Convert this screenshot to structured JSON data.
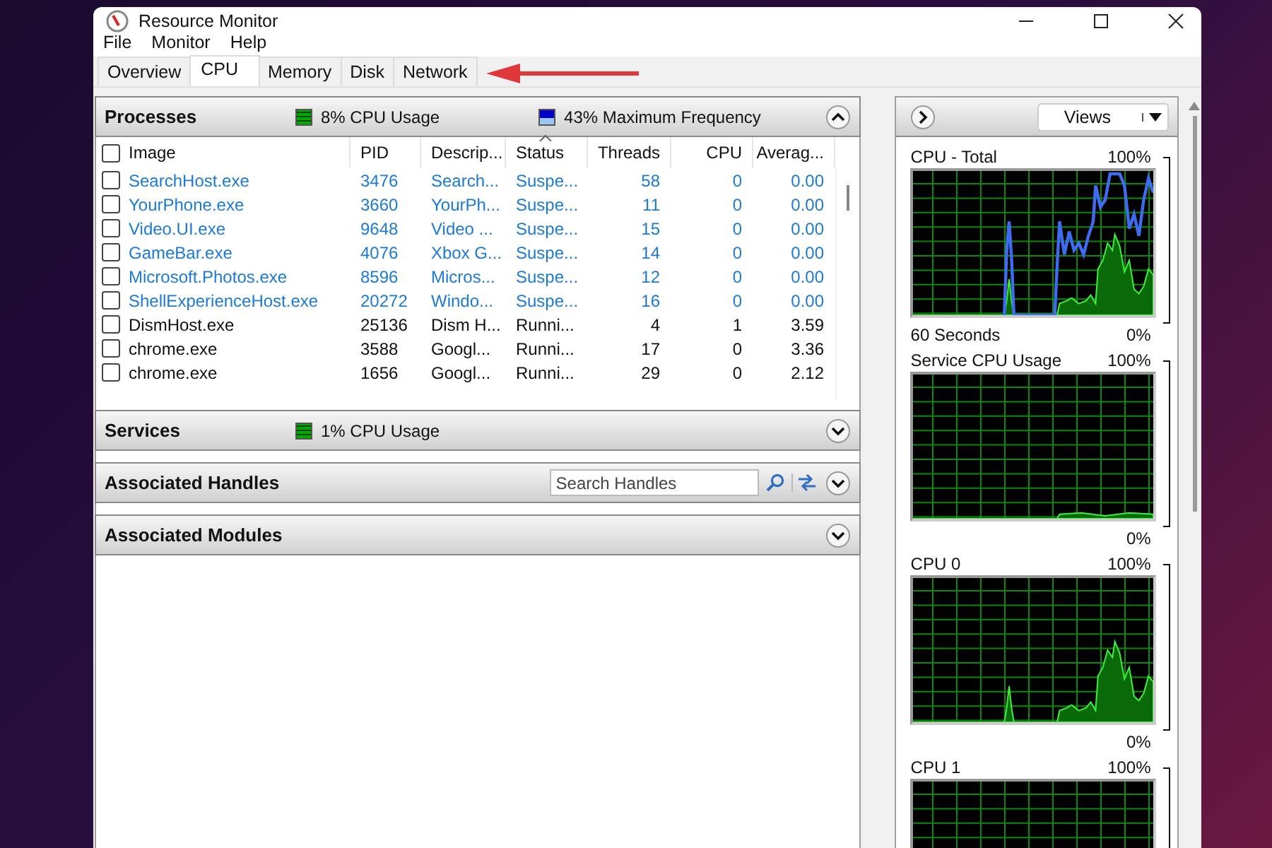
{
  "window": {
    "title": "Resource Monitor"
  },
  "menu": [
    "File",
    "Monitor",
    "Help"
  ],
  "tabs": [
    {
      "label": "Overview",
      "selected": false
    },
    {
      "label": "CPU",
      "selected": true
    },
    {
      "label": "Memory",
      "selected": false
    },
    {
      "label": "Disk",
      "selected": false
    },
    {
      "label": "Network",
      "selected": false
    }
  ],
  "processes": {
    "title": "Processes",
    "select_all_checked": false,
    "cpu_usage": "8% CPU Usage",
    "max_frequency": "43% Maximum Frequency",
    "expanded": true,
    "columns": [
      "Image",
      "PID",
      "Descrip...",
      "Status",
      "Threads",
      "CPU",
      "Averag..."
    ],
    "rows": [
      {
        "image": "SearchHost.exe",
        "pid": "3476",
        "description": "Search...",
        "status": "Suspe...",
        "threads": "58",
        "cpu": "0",
        "average": "0.00",
        "checked": false,
        "suspended": true
      },
      {
        "image": "YourPhone.exe",
        "pid": "3660",
        "description": "YourPh...",
        "status": "Suspe...",
        "threads": "11",
        "cpu": "0",
        "average": "0.00",
        "checked": false,
        "suspended": true
      },
      {
        "image": "Video.UI.exe",
        "pid": "9648",
        "description": "Video ...",
        "status": "Suspe...",
        "threads": "15",
        "cpu": "0",
        "average": "0.00",
        "checked": false,
        "suspended": true
      },
      {
        "image": "GameBar.exe",
        "pid": "4076",
        "description": "Xbox G...",
        "status": "Suspe...",
        "threads": "14",
        "cpu": "0",
        "average": "0.00",
        "checked": false,
        "suspended": true
      },
      {
        "image": "Microsoft.Photos.exe",
        "pid": "8596",
        "description": "Micros...",
        "status": "Suspe...",
        "threads": "12",
        "cpu": "0",
        "average": "0.00",
        "checked": false,
        "suspended": true
      },
      {
        "image": "ShellExperienceHost.exe",
        "pid": "20272",
        "description": "Windo...",
        "status": "Suspe...",
        "threads": "16",
        "cpu": "0",
        "average": "0.00",
        "checked": false,
        "suspended": true
      },
      {
        "image": "DismHost.exe",
        "pid": "25136",
        "description": "Dism H...",
        "status": "Runni...",
        "threads": "4",
        "cpu": "1",
        "average": "3.59",
        "checked": false,
        "suspended": false
      },
      {
        "image": "chrome.exe",
        "pid": "3588",
        "description": "Googl...",
        "status": "Runni...",
        "threads": "17",
        "cpu": "0",
        "average": "3.36",
        "checked": false,
        "suspended": false
      },
      {
        "image": "chrome.exe",
        "pid": "1656",
        "description": "Googl...",
        "status": "Runni...",
        "threads": "29",
        "cpu": "0",
        "average": "2.12",
        "checked": false,
        "suspended": false
      }
    ]
  },
  "services": {
    "title": "Services",
    "cpu_usage": "1% CPU Usage",
    "expanded": false
  },
  "handles": {
    "title": "Associated Handles",
    "search": {
      "placeholder": "Search Handles"
    },
    "expanded": false
  },
  "modules": {
    "title": "Associated Modules",
    "expanded": false
  },
  "graphs_panel": {
    "views_button": "Views",
    "graphs": [
      {
        "title": "CPU - Total",
        "max": "100%",
        "time": "60 Seconds",
        "min": "0%"
      },
      {
        "title": "Service CPU Usage",
        "max": "100%",
        "min": "0%"
      },
      {
        "title": "CPU 0",
        "max": "100%",
        "min": "0%"
      },
      {
        "title": "CPU 1",
        "max": "100%"
      }
    ]
  }
}
